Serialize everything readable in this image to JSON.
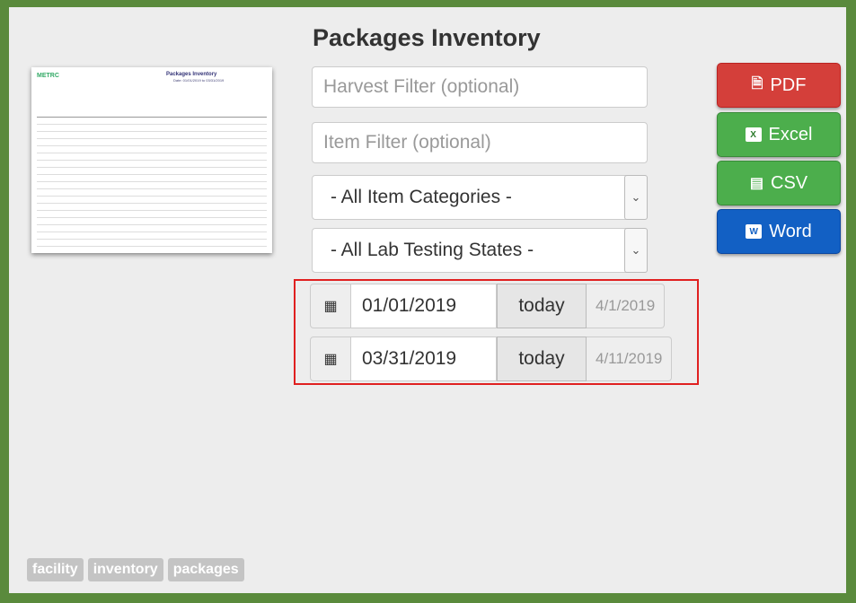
{
  "page": {
    "title": "Packages Inventory"
  },
  "preview": {
    "logo": "METRC",
    "title": "Packages Inventory",
    "subtitle": "Date: 01/01/2019 to 03/31/2019"
  },
  "filters": {
    "harvest_placeholder": "Harvest Filter (optional)",
    "item_placeholder": "Item Filter (optional)",
    "item_category": "- All Item Categories -",
    "lab_testing_state": "- All Lab Testing States -"
  },
  "dates": {
    "start": {
      "value": "01/01/2019",
      "today_label": "today",
      "hint": "4/1/2019"
    },
    "end": {
      "value": "03/31/2019",
      "today_label": "today",
      "hint": "4/11/2019"
    }
  },
  "export": {
    "pdf_label": "PDF",
    "excel_label": "Excel",
    "csv_label": "CSV",
    "word_label": "Word"
  },
  "tags": [
    "facility",
    "inventory",
    "packages"
  ],
  "colors": {
    "frame": "#5a8a3c",
    "pdf": "#d43f3a",
    "excel": "#4cae4c",
    "word": "#1260c4",
    "highlight": "#e02020"
  },
  "icons": {
    "pdf": "pdf-icon",
    "excel": "excel-icon",
    "csv": "csv-icon",
    "word": "word-icon",
    "calendar": "calendar-icon",
    "select": "chevron-down-icon"
  }
}
